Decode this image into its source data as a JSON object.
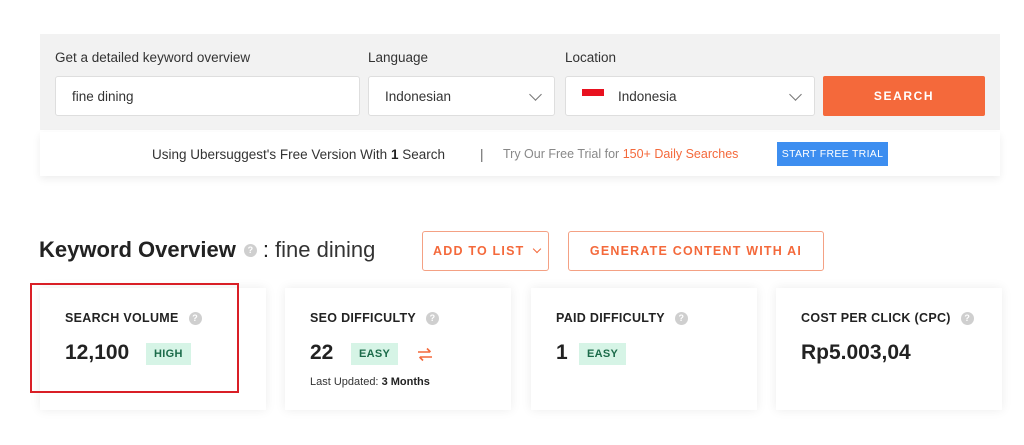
{
  "search": {
    "keyword_label": "Get a detailed keyword overview",
    "keyword_value": "fine dining",
    "language_label": "Language",
    "language_value": "Indonesian",
    "location_label": "Location",
    "location_value": "Indonesia",
    "search_button": "SEARCH"
  },
  "trial": {
    "left_prefix": "Using Ubersuggest's Free Version With ",
    "left_count": "1",
    "left_suffix": " Search",
    "separator": "|",
    "right_prefix": "Try Our Free Trial for ",
    "right_highlight": "150+ Daily Searches",
    "button": "START FREE TRIAL"
  },
  "overview": {
    "title": "Keyword Overview",
    "colon": ":",
    "keyword": "fine dining",
    "help_icon": "?",
    "add_to_list": "ADD TO LIST",
    "generate": "GENERATE CONTENT WITH AI"
  },
  "metrics": [
    {
      "name": "SEARCH VOLUME",
      "value": "12,100",
      "badge": "HIGH"
    },
    {
      "name": "SEO DIFFICULTY",
      "value": "22",
      "badge": "EASY",
      "updated_label": "Last Updated: ",
      "updated_value": "3 Months"
    },
    {
      "name": "PAID DIFFICULTY",
      "value": "1",
      "badge": "EASY"
    },
    {
      "name": "COST PER CLICK (CPC)",
      "value": "Rp5.003,04"
    }
  ],
  "colors": {
    "accent": "#f4693b",
    "trial_button": "#3d8ef0",
    "badge_bg": "#d6f4e6",
    "highlight_border": "#d91f26"
  }
}
